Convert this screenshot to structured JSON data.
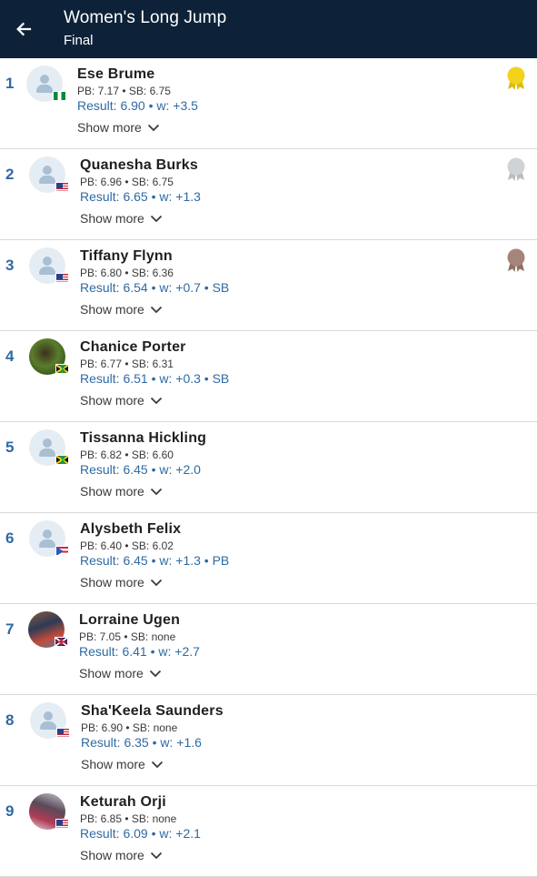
{
  "header": {
    "title": "Women's Long Jump",
    "subtitle": "Final"
  },
  "show_more_label": "Show more",
  "athletes": [
    {
      "rank": "1",
      "name": "Ese Brume",
      "stats": "PB: 7.17 • SB: 6.75",
      "result": "Result: 6.90 • w: +3.5",
      "flag": "nigeria-flag",
      "avatar": "placeholder",
      "medal": "gold"
    },
    {
      "rank": "2",
      "name": "Quanesha Burks",
      "stats": "PB: 6.96 • SB: 6.75",
      "result": "Result: 6.65 • w: +1.3",
      "flag": "usa-flag",
      "avatar": "placeholder",
      "medal": "silver"
    },
    {
      "rank": "3",
      "name": "Tiffany Flynn",
      "stats": "PB: 6.80 • SB: 6.36",
      "result": "Result: 6.54 • w: +0.7 • SB",
      "flag": "usa-flag",
      "avatar": "placeholder",
      "medal": "bronze"
    },
    {
      "rank": "4",
      "name": "Chanice Porter",
      "stats": "PB: 6.77 • SB: 6.31",
      "result": "Result: 6.51 • w: +0.3 • SB",
      "flag": "jamaica-flag",
      "avatar": "photo",
      "medal": null
    },
    {
      "rank": "5",
      "name": "Tissanna Hickling",
      "stats": "PB: 6.82 • SB: 6.60",
      "result": "Result: 6.45 • w: +2.0",
      "flag": "jamaica-flag",
      "avatar": "placeholder",
      "medal": null
    },
    {
      "rank": "6",
      "name": "Alysbeth Felix",
      "stats": "PB: 6.40 • SB: 6.02",
      "result": "Result: 6.45 • w: +1.3 • PB",
      "flag": "puerto-rico-flag",
      "avatar": "placeholder",
      "medal": null
    },
    {
      "rank": "7",
      "name": "Lorraine Ugen",
      "stats": "PB: 7.05 • SB: none",
      "result": "Result: 6.41 • w: +2.7",
      "flag": "uk-flag",
      "avatar": "photo",
      "medal": null
    },
    {
      "rank": "8",
      "name": "Sha'Keela Saunders",
      "stats": "PB: 6.90 • SB: none",
      "result": "Result: 6.35 • w: +1.6",
      "flag": "usa-flag",
      "avatar": "placeholder",
      "medal": null
    },
    {
      "rank": "9",
      "name": "Keturah Orji",
      "stats": "PB: 6.85 • SB: none",
      "result": "Result: 6.09 • w: +2.1",
      "flag": "usa-flag",
      "avatar": "photo",
      "medal": null
    }
  ],
  "colors": {
    "header_bg": "#0d2238",
    "accent_blue": "#2f6aa3",
    "gold": "#f2d21b",
    "silver": "#cfd3d6",
    "bronze": "#a5857a"
  }
}
